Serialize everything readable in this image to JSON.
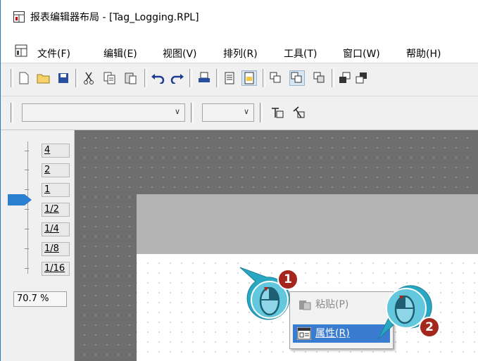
{
  "window": {
    "title": "报表编辑器布局 - [Tag_Logging.RPL]"
  },
  "menu": {
    "items": [
      "文件(F)",
      "编辑(E)",
      "视图(V)",
      "排列(R)",
      "工具(T)",
      "窗口(W)",
      "帮助(H)"
    ]
  },
  "toolbar": {
    "icons": [
      "new-document-icon",
      "open-folder-icon",
      "save-icon",
      "cut-icon",
      "copy-icon",
      "paste-icon",
      "undo-icon",
      "redo-icon",
      "print-icon",
      "page-icon",
      "page-highlight-icon",
      "align-left-icon",
      "align-center-icon",
      "align-right-icon",
      "bring-front-icon",
      "send-back-icon"
    ]
  },
  "format_bar": {
    "font_combo_value": "",
    "size_combo_value": ""
  },
  "zoom": {
    "levels": [
      "4",
      "2",
      "1",
      "1/2",
      "1/4",
      "1/8",
      "1/16"
    ],
    "current": "70.7 %"
  },
  "context_menu": {
    "paste_label": "粘贴(P)",
    "properties_label": "属性(R)"
  },
  "steps": {
    "step1": "1",
    "step2": "2"
  },
  "colors": {
    "accent": "#3a7ccf",
    "badge": "#a3271d",
    "mouse": "#1d9bb5"
  }
}
